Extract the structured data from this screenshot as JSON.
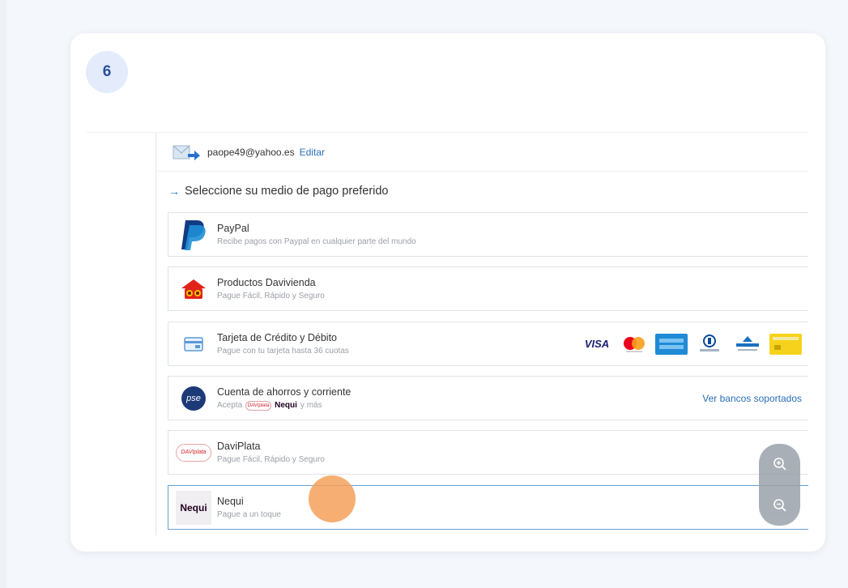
{
  "step": {
    "number": "6"
  },
  "account": {
    "email": "paope49@yahoo.es",
    "edit_label": "Editar"
  },
  "section": {
    "title": "Seleccione su medio de pago preferido"
  },
  "options": [
    {
      "name": "PayPal",
      "desc": "Recibe pagos con Paypal en cualquier parte del mundo"
    },
    {
      "name": "Productos Davivienda",
      "desc": "Pague Fácil, Rápido y Seguro"
    },
    {
      "name": "Tarjeta de Crédito y Débito",
      "desc": "Pague con tu tarjeta hasta 36 cuotas"
    },
    {
      "name": "Cuenta de ahorros y corriente",
      "desc_prefix": "Acepta",
      "desc_suffix": "y más",
      "link": "Ver bancos soportados"
    },
    {
      "name": "DaviPlata",
      "desc": "Pague Fácil, Rápido y Seguro"
    },
    {
      "name": "Nequi",
      "desc": "Pague a un toque"
    }
  ],
  "logos": {
    "pse": "pse",
    "daviplata": "DAVIplata",
    "nequi": "Nequi",
    "visa": "VISA"
  },
  "icons": {
    "zoom_in": "zoom-in-icon",
    "zoom_out": "zoom-out-icon",
    "email": "email-arrow-icon"
  },
  "colors": {
    "accent_blue": "#2a6fb8",
    "badge_bg": "#e4ebfb",
    "selected_border": "#6a9fd1",
    "cursor": "#f5a05a"
  }
}
